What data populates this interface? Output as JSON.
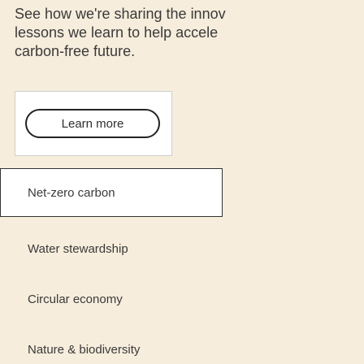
{
  "intro": {
    "lines": [
      "See how we're sharing the innov",
      "lessons we learn to help accele",
      "carbon-free future."
    ]
  },
  "learn_more": {
    "label": "Learn more"
  },
  "topics": {
    "items": [
      {
        "label": "Net-zero carbon",
        "active": true
      },
      {
        "label": "Water stewardship",
        "active": false
      },
      {
        "label": "Circular economy",
        "active": false
      },
      {
        "label": "Nature & biodiversity",
        "active": false
      }
    ]
  },
  "colors": {
    "background": "#f6eddc",
    "card": "#ffffff",
    "text": "#3a3a3a",
    "border": "#333333"
  }
}
